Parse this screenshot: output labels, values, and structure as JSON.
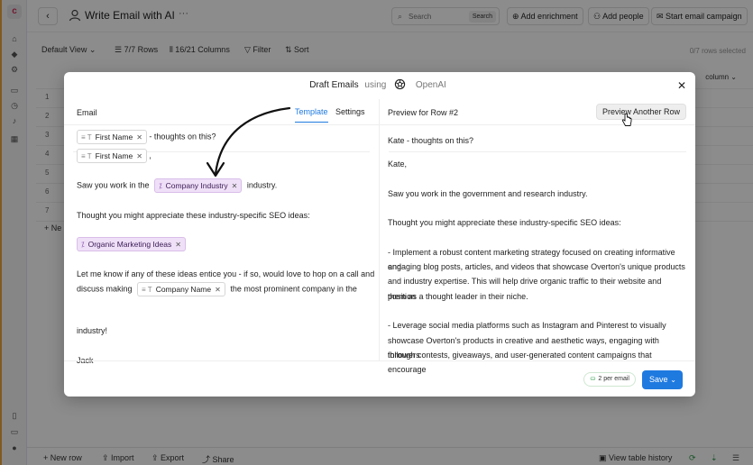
{
  "header": {
    "title": "Write Email with AI",
    "search_placeholder": "Search",
    "search_button": "Search",
    "add_enrichment": "Add enrichment",
    "add_people": "Add people",
    "start_campaign": "Start email campaign"
  },
  "toolbar": {
    "view": "Default View",
    "rows": "7/7 Rows",
    "columns": "16/21 Columns",
    "filter": "Filter",
    "sort": "Sort",
    "rows_selected": "0/7 rows selected"
  },
  "grid": {
    "rows": [
      "1",
      "2",
      "3",
      "4",
      "5",
      "6",
      "7"
    ],
    "add_column": "column",
    "new_row_partial": "Ne"
  },
  "bottom": {
    "new_row": "New row",
    "import": "Import",
    "export": "Export",
    "share": "Share",
    "view_history": "View table history"
  },
  "modal": {
    "title": "Draft Emails",
    "using": "using",
    "provider": "OpenAI",
    "left_label": "Email",
    "tab_template": "Template",
    "tab_settings": "Settings",
    "subject_suffix": "- thoughts on this?",
    "greeting_suffix": ",",
    "chip_first_name": "First Name",
    "chip_company_industry": "Company Industry",
    "chip_organic_ideas": "Organic Marketing Ideas",
    "chip_company_name": "Company Name",
    "body_saw_prefix": "Saw you work in the",
    "body_saw_suffix": "industry.",
    "body_thought": "Thought you might appreciate these industry-specific SEO ideas:",
    "body_letme_1": "Let me know if any of these ideas entice you - if so, would love to hop on a call and",
    "body_letme_2_prefix": "discuss making",
    "body_letme_2_suffix": "the most prominent company in the",
    "body_letme_3": "industry!",
    "body_sign": "Jack",
    "preview_label": "Preview for Row #2",
    "preview_button": "Preview Another Row",
    "preview_subject": "Kate - thoughts on this?",
    "preview_lines": [
      "Kate,",
      "",
      "Saw you work in the government and research industry.",
      "",
      "Thought you might appreciate these industry-specific SEO ideas:",
      "",
      "- Implement a robust content marketing strategy focused on creating informative and",
      "engaging blog posts, articles, and videos that showcase Overton's unique products",
      "and industry expertise. This will help drive organic traffic to their website and position",
      "them as a thought leader in their niche.",
      "",
      "- Leverage social media platforms such as Instagram and Pinterest to visually",
      "showcase Overton's products in creative and aesthetic ways, engaging with followers",
      "through contests, giveaways, and user-generated content campaigns that encourage"
    ],
    "credit": "2 per email",
    "save": "Save"
  },
  "icons": {
    "accent": "#1f7ae0",
    "chip_purple": "#efe0f7"
  }
}
